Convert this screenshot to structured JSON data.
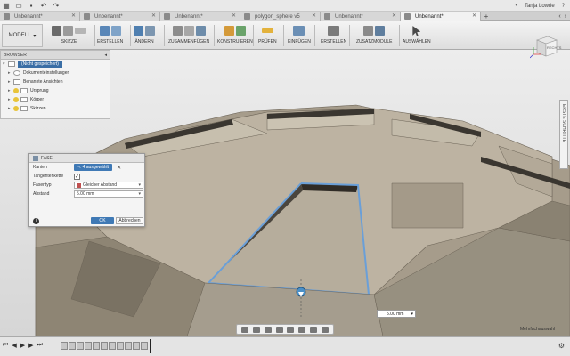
{
  "user": "Tanja Lowrie",
  "tabs": [
    {
      "label": "Unbenannt*",
      "active": false
    },
    {
      "label": "Unbenannt*",
      "active": false
    },
    {
      "label": "Unbenannt*",
      "active": false
    },
    {
      "label": "polygon_sphere v5",
      "active": false
    },
    {
      "label": "Unbenannt*",
      "active": false
    },
    {
      "label": "Unbenannt*",
      "active": true
    }
  ],
  "toolbar": {
    "workspace": "MODELL",
    "groups": [
      "SKIZZE",
      "ERSTELLEN",
      "ÄNDERN",
      "ZUSAMMENFÜGEN",
      "KONSTRUIEREN",
      "PRÜFEN",
      "EINFÜGEN",
      "ERSTELLEN",
      "ZUSATZMODULE",
      "AUSWÄHLEN"
    ]
  },
  "browser": {
    "title": "BROWSER",
    "root": "(Nicht gespeichert)",
    "items": [
      "Dokumenteinstellungen",
      "Benannte Ansichten",
      "Ursprung",
      "Körper",
      "Skizzen"
    ]
  },
  "dialog": {
    "title": "FASE",
    "rows": {
      "kanten_label": "Kanten",
      "kanten_value": "4 ausgewählt",
      "tangent_label": "Tangentenkette",
      "fasentyp_label": "Fasentyp",
      "fasentyp_value": "Gleicher Abstand",
      "abstand_label": "Abstand",
      "abstand_value": "5.00 mm"
    },
    "ok": "OK",
    "cancel": "Abbrechen"
  },
  "viewcube_label": "RECHTS",
  "side_panel": "ERSTE SCHRITTE",
  "distance_input": "5.00 mm",
  "status_hint": "Mehrfachauswahl",
  "colors": {
    "accent": "#3f79b5",
    "model": "#b8ad9a",
    "selection": "#6a9fd8"
  }
}
